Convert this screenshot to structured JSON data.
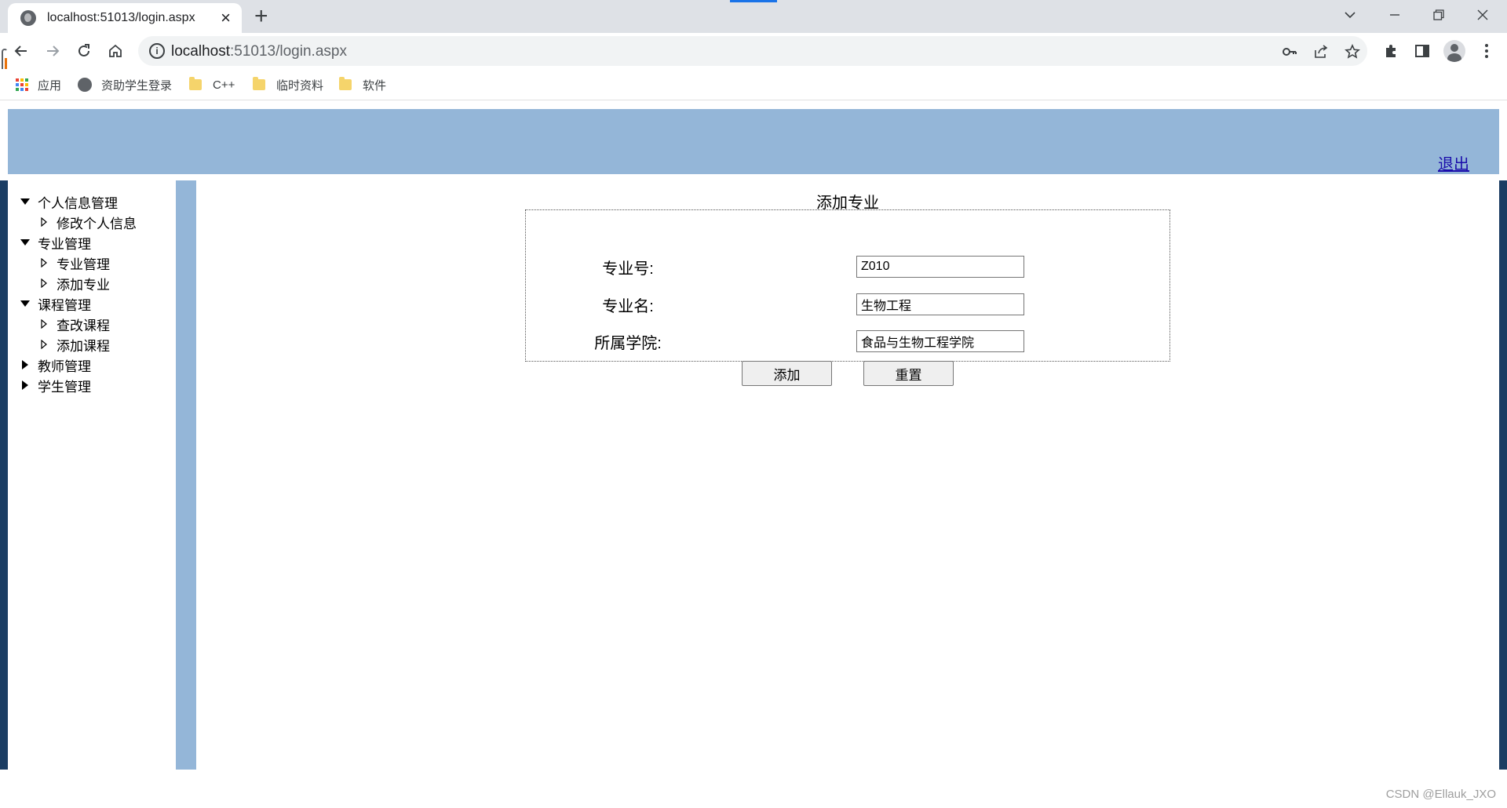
{
  "browser": {
    "tab_title": "localhost:51013/login.aspx",
    "new_tab": "+",
    "url_host": "localhost",
    "url_path": ":51013/login.aspx",
    "bookmarks": [
      {
        "label": "应用",
        "icon": "apps-grid-icon"
      },
      {
        "label": "资助学生登录",
        "icon": "globe-icon"
      },
      {
        "label": "C++",
        "icon": "folder-icon"
      },
      {
        "label": "临时资料",
        "icon": "folder-icon"
      },
      {
        "label": "软件",
        "icon": "folder-icon"
      }
    ]
  },
  "header": {
    "logout_label": "退出",
    "background": "#94b6d8"
  },
  "sidebar": {
    "tree": [
      {
        "label": "个人信息管理",
        "expanded": true,
        "children": [
          "修改个人信息"
        ]
      },
      {
        "label": "专业管理",
        "expanded": true,
        "children": [
          "专业管理",
          "添加专业"
        ]
      },
      {
        "label": "课程管理",
        "expanded": true,
        "children": [
          "查改课程",
          "添加课程"
        ]
      },
      {
        "label": "教师管理",
        "expanded": false,
        "children": []
      },
      {
        "label": "学生管理",
        "expanded": false,
        "children": []
      }
    ]
  },
  "form": {
    "title": "添加专业",
    "fields": [
      {
        "label": "专业号:",
        "value": "Z010"
      },
      {
        "label": "专业名:",
        "value": "生物工程"
      },
      {
        "label": "所属学院:",
        "value": "食品与生物工程学院"
      }
    ],
    "add_button": "添加",
    "reset_button": "重置"
  },
  "watermark": "CSDN @Ellauk_JXO"
}
